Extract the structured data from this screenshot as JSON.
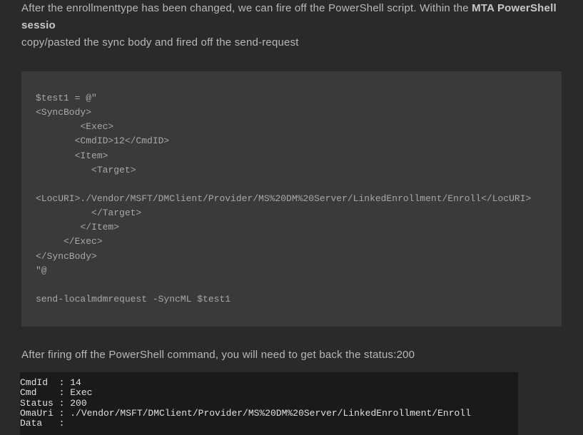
{
  "intro": {
    "part1": "After the enrollmenttype has been changed, we can fire off the PowerShell script. Within the ",
    "bold": "MTA PowerShell sessio",
    "part2": "copy/pasted the sync body and fired off the send-request"
  },
  "code_block": "$test1 = @\"\n<SyncBody>\n        <Exec>\n       <CmdID>12</CmdID>\n       <Item>\n          <Target>\n\n<LocURI>./Vendor/MSFT/DMClient/Provider/MS%20DM%20Server/LinkedEnrollment/Enroll</LocURI>\n          </Target>\n        </Item>\n     </Exec>\n</SyncBody>\n\"@\n\nsend-localmdmrequest -SyncML $test1",
  "paragraph2": "After firing off the PowerShell command, you will need to get back the status:200",
  "output_block": "CmdId  : 14\nCmd    : Exec\nStatus : 200\nOmaUri : ./Vendor/MSFT/DMClient/Provider/MS%20DM%20Server/LinkedEnrollment/Enroll\nData   :"
}
